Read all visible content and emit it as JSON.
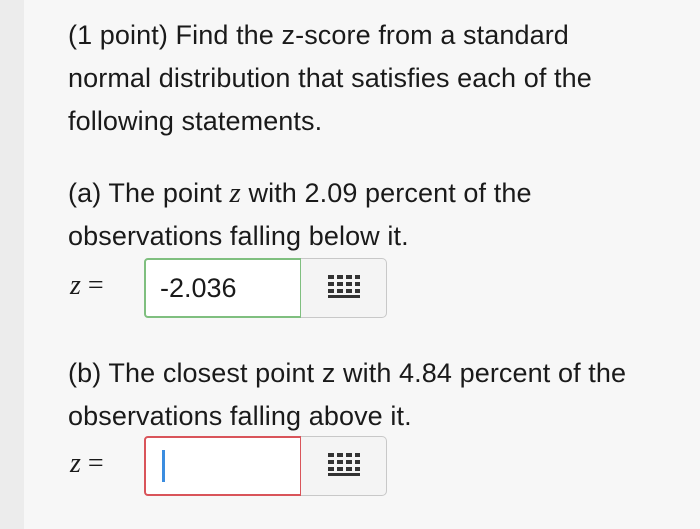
{
  "intro_lines": [
    "(1 point) Find the z-score from a standard",
    "normal distribution that satisfies each of the",
    "following statements."
  ],
  "part_a": {
    "line1_before": "(a) The point ",
    "var": "z",
    "line1_after": " with 2.09 percent of the",
    "line2": "observations falling below it.",
    "label_var": "z",
    "label_eq": " = ",
    "answer_value": "-2.036"
  },
  "part_b": {
    "line1_before": "(b) The closest point z with 4.84 percent of the",
    "line2": "observations falling above it.",
    "label_var": "z",
    "label_eq": " = ",
    "answer_value": ""
  },
  "icons": {
    "keyboard": "equation-editor-icon"
  },
  "colors": {
    "field_ok_border": "#7fbf7f",
    "field_error_border": "#d9545a",
    "caret": "#3b8de0"
  }
}
